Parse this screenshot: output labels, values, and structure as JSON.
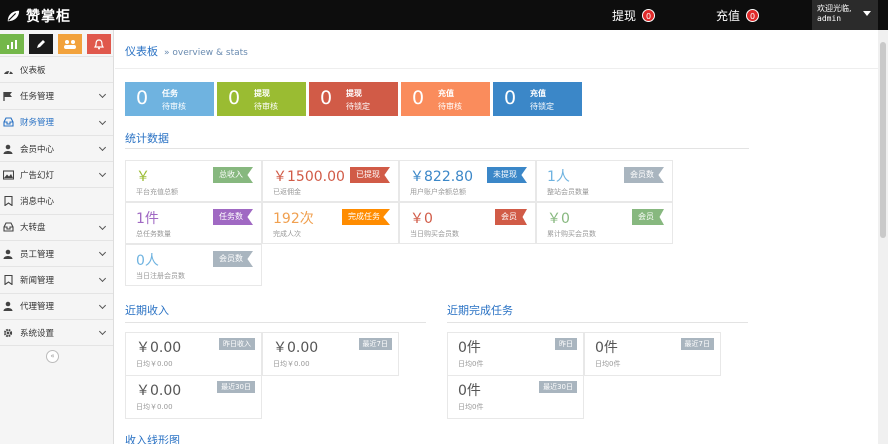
{
  "header": {
    "app_name": "赞掌柜",
    "withdraw_label": "提现",
    "withdraw_count": "0",
    "recharge_label": "充值",
    "recharge_count": "0",
    "welcome": "欢迎光临,",
    "username": "admin"
  },
  "sidebar": {
    "shortcut_colors": [
      "#74b74a",
      "#1a1a1a",
      "#f2a23c",
      "#e0584c"
    ],
    "items": [
      {
        "label": "仪表板",
        "icon": "dashboard-icon",
        "has_children": false
      },
      {
        "label": "任务管理",
        "icon": "flag-icon",
        "has_children": true
      },
      {
        "label": "财务管理",
        "icon": "inbox-icon",
        "has_children": true
      },
      {
        "label": "会员中心",
        "icon": "user-icon",
        "has_children": true
      },
      {
        "label": "广告幻灯",
        "icon": "picture-icon",
        "has_children": true
      },
      {
        "label": "消息中心",
        "icon": "bookmark-icon",
        "has_children": false
      },
      {
        "label": "大转盘",
        "icon": "inbox-icon",
        "has_children": true
      },
      {
        "label": "员工管理",
        "icon": "user-icon",
        "has_children": true
      },
      {
        "label": "新闻管理",
        "icon": "bookmark-icon",
        "has_children": true
      },
      {
        "label": "代理管理",
        "icon": "user-icon",
        "has_children": true
      },
      {
        "label": "系统设置",
        "icon": "gear-icon",
        "has_children": true
      }
    ],
    "active_index": 2,
    "collapse_glyph": "«"
  },
  "breadcrumb": {
    "title": "仪表板",
    "subtitle": "» overview & stats"
  },
  "tiles": [
    {
      "value": "0",
      "line1": "任务",
      "line2": "待审核",
      "color": "#6fb3e0"
    },
    {
      "value": "0",
      "line1": "提现",
      "line2": "待审核",
      "color": "#9abc32"
    },
    {
      "value": "0",
      "line1": "提现",
      "line2": "待锁定",
      "color": "#d15b47"
    },
    {
      "value": "0",
      "line1": "充值",
      "line2": "待审核",
      "color": "#fa8c5c"
    },
    {
      "value": "0",
      "line1": "充值",
      "line2": "待锁定",
      "color": "#3b87c8"
    }
  ],
  "stats_section": {
    "title": "统计数据",
    "items": [
      {
        "value": "￥",
        "desc": "平台充值总额",
        "tag": "总收入",
        "value_color": "#9abc32",
        "tag_color": "#87b87f"
      },
      {
        "value": "￥1500.00",
        "desc": "已返佣金",
        "tag": "已提现",
        "value_color": "#d15b47",
        "tag_color": "#d15b47"
      },
      {
        "value": "￥822.80",
        "desc": "用户账户余额总额",
        "tag": "未提现",
        "value_color": "#3b87c8",
        "tag_color": "#3b87c8"
      },
      {
        "value": "1人",
        "desc": "整站会员数量",
        "tag": "会员数",
        "value_color": "#6fb3e0",
        "tag_color": "#a9b5bf"
      },
      {
        "value": "1件",
        "desc": "总任务数量",
        "tag": "任务数",
        "value_color": "#a069c3",
        "tag_color": "#a069c3"
      },
      {
        "value": "192次",
        "desc": "完成人次",
        "tag": "完成任务",
        "value_color": "#f0a050",
        "tag_color": "#ff8c00"
      },
      {
        "value": "￥0",
        "desc": "当日购买会员数",
        "tag": "会员",
        "value_color": "#d15b47",
        "tag_color": "#d15b47"
      },
      {
        "value": "￥0",
        "desc": "累计购买会员数",
        "tag": "会员",
        "value_color": "#87b87f",
        "tag_color": "#87b87f"
      },
      {
        "value": "0人",
        "desc": "当日注册会员数",
        "tag": "会员数",
        "value_color": "#6fb3e0",
        "tag_color": "#a9b5bf"
      }
    ]
  },
  "income_section": {
    "title": "近期收入",
    "items": [
      {
        "value": "￥0.00",
        "desc": "日均￥0.00",
        "tag": "昨日收入"
      },
      {
        "value": "￥0.00",
        "desc": "日均￥0.00",
        "tag": "最近7日"
      },
      {
        "value": "￥0.00",
        "desc": "日均￥0.00",
        "tag": "最近30日"
      }
    ]
  },
  "tasks_section": {
    "title": "近期完成任务",
    "items": [
      {
        "value": "0件",
        "desc": "日均0件",
        "tag": "昨日"
      },
      {
        "value": "0件",
        "desc": "日均0件",
        "tag": "最近7日"
      },
      {
        "value": "0件",
        "desc": "日均0件",
        "tag": "最近30日"
      }
    ]
  },
  "chart_section": {
    "title": "收入线形图"
  }
}
